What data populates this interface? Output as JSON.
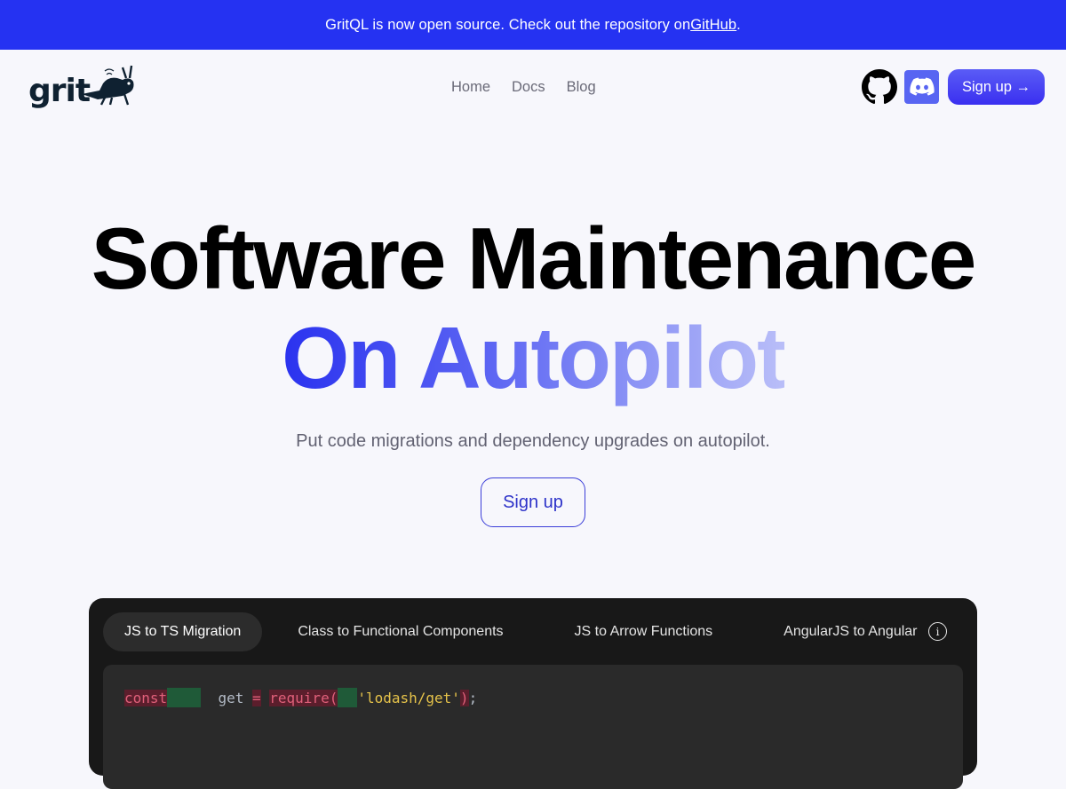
{
  "banner": {
    "text_before": "GritQL is now open source. Check out the repository on ",
    "link_label": "GitHub",
    "text_after": "."
  },
  "nav": {
    "logo_text": "grit",
    "links": [
      {
        "label": "Home"
      },
      {
        "label": "Docs"
      },
      {
        "label": "Blog"
      }
    ],
    "signup_label": "Sign up →",
    "icons": [
      "github-icon",
      "discord-icon"
    ]
  },
  "hero": {
    "title": "Software Maintenance",
    "subtitle": "On Autopilot",
    "tagline": "Put code migrations and dependency upgrades on autopilot.",
    "cta_label": "Sign up"
  },
  "demo": {
    "tabs": [
      {
        "label": "JS to TS Migration",
        "active": true
      },
      {
        "label": "Class to Functional Components",
        "active": false
      },
      {
        "label": "JS to Arrow Functions",
        "active": false
      },
      {
        "label": "AngularJS to Angular",
        "active": false
      }
    ],
    "info_icon": "info-icon",
    "code": {
      "tok_const": "const",
      "tok_get": "get",
      "tok_eq": "=",
      "tok_require": "require(",
      "tok_str": "'lodash/get'",
      "tok_close": ")",
      "tok_semi": ";"
    }
  },
  "colors": {
    "banner_bg": "#2532f2",
    "accent": "#3a2ff0",
    "discord": "#5865f2",
    "page_bg": "#f7f7fc",
    "demo_bg": "#181818"
  }
}
